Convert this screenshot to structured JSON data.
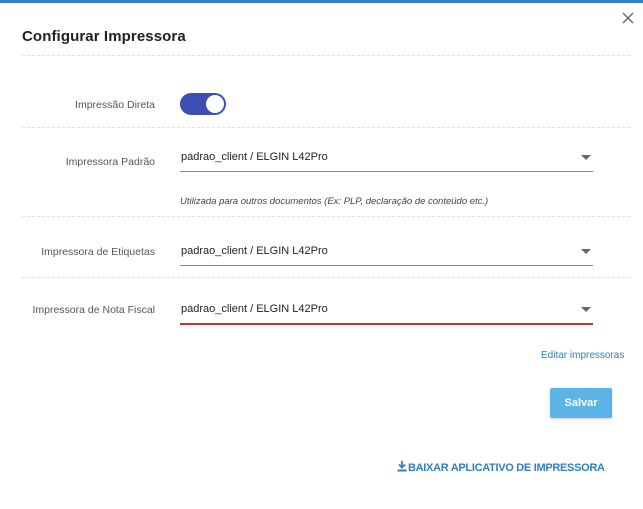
{
  "dialog": {
    "title": "Configurar Impressora",
    "close_icon": "close-icon"
  },
  "fields": {
    "direct_print": {
      "label": "Impressão Direta",
      "enabled": true,
      "toggle_color": "#3d4fb5"
    },
    "default_printer": {
      "label": "Impressora Padrão",
      "value": "padrao_client / ELGIN L42Pro",
      "hint": "Utilizada para outros documentos (Ex: PLP, declaração de conteúdo etc.)"
    },
    "label_printer": {
      "label": "Impressora de Etiquetas",
      "value": "padrao_client / ELGIN L42Pro"
    },
    "invoice_printer": {
      "label": "Impressora de Nota Fiscal",
      "value": "padrao_client / ELGIN L42Pro",
      "error_color": "#c0392b"
    }
  },
  "actions": {
    "edit_printers": "Editar impressoras",
    "save": "Salvar",
    "download_app": "BAIXAR APLICATIVO DE IMPRESSORA",
    "download_icon": "download-icon"
  },
  "colors": {
    "accent": "#2f7fc2",
    "save_button": "#5bb4e5"
  }
}
